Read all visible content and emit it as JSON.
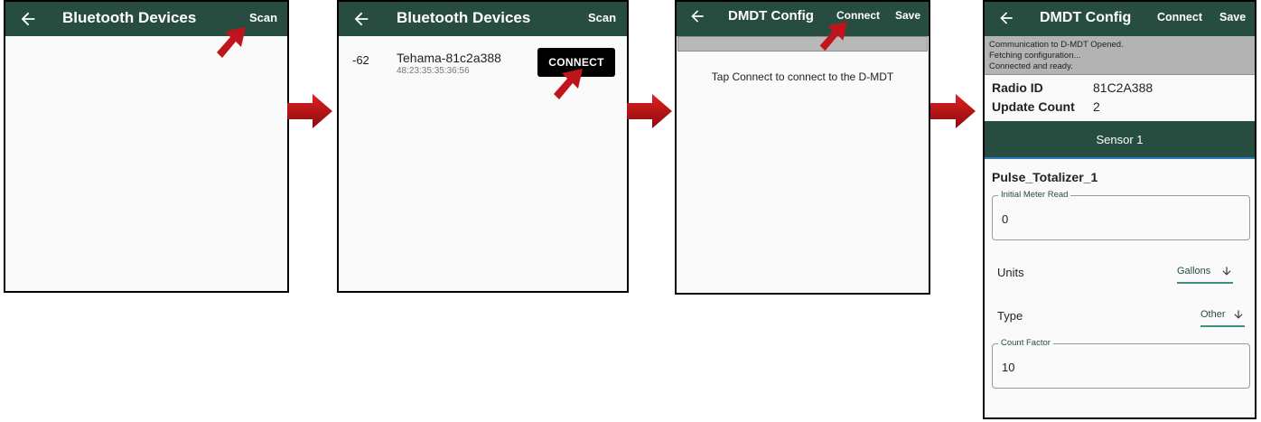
{
  "panels": {
    "p1": {
      "title": "Bluetooth Devices",
      "action": "Scan"
    },
    "p2": {
      "title": "Bluetooth Devices",
      "action": "Scan",
      "device": {
        "rssi": "-62",
        "name": "Tehama-81c2a388",
        "mac": "48:23:35:35:36:56",
        "connect_label": "CONNECT"
      }
    },
    "p3": {
      "title": "DMDT Config",
      "connect_label": "Connect",
      "save_label": "Save",
      "hint": "Tap Connect to connect to the D-MDT"
    },
    "p4": {
      "title": "DMDT Config",
      "connect_label": "Connect",
      "save_label": "Save",
      "log": [
        "Communication to D-MDT Opened.",
        "Fetching configuration...",
        "Connected and ready."
      ],
      "radio_id_label": "Radio ID",
      "radio_id_value": "81C2A388",
      "update_count_label": "Update Count",
      "update_count_value": "2",
      "sensor_tab": "Sensor 1",
      "sensor_name": "Pulse_Totalizer_1",
      "initial_meter_read_label": "Initial Meter Read",
      "initial_meter_read_value": "0",
      "units_label": "Units",
      "units_value": "Gallons",
      "type_label": "Type",
      "type_value": "Other",
      "count_factor_label": "Count Factor",
      "count_factor_value": "10"
    }
  },
  "colors": {
    "appbar": "#264d3f",
    "annotation_red": "#c0141c",
    "accent_teal": "#3f8f85"
  },
  "icons": {
    "back": "arrow-left-icon",
    "dropdown": "arrow-down-icon",
    "flow": "right-arrow-icon",
    "pointer": "pointer-arrow-icon"
  }
}
